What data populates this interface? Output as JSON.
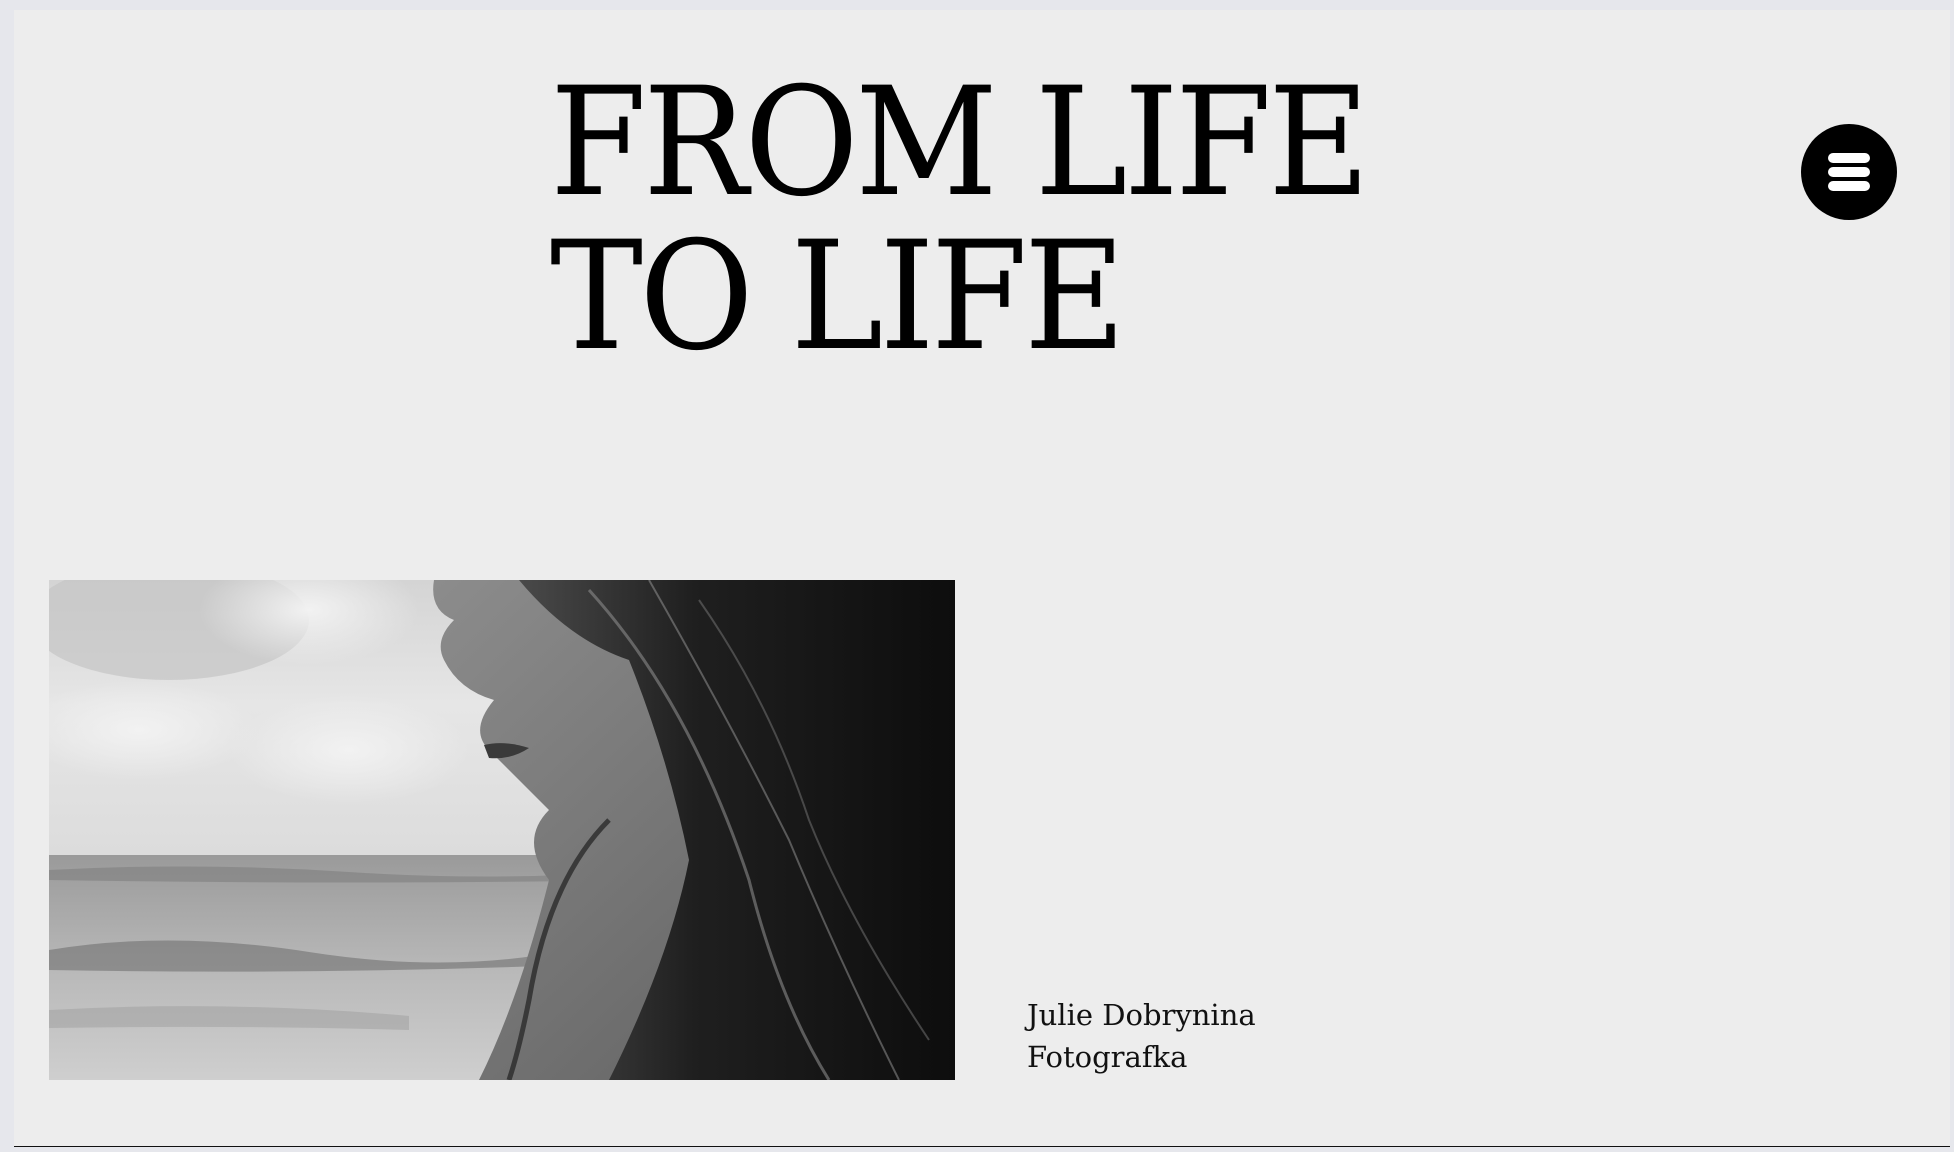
{
  "hero": {
    "line1": "FROM LIFE",
    "line2": "TO LIFE"
  },
  "menu": {
    "icon": "hamburger-menu-icon"
  },
  "photo": {
    "description_icon": "portrait-photo"
  },
  "caption": {
    "name": "Julie Dobrynina",
    "role": "Fotografka"
  },
  "colors": {
    "background": "#ededed",
    "text": "#000000",
    "menu_button": "#000000"
  }
}
